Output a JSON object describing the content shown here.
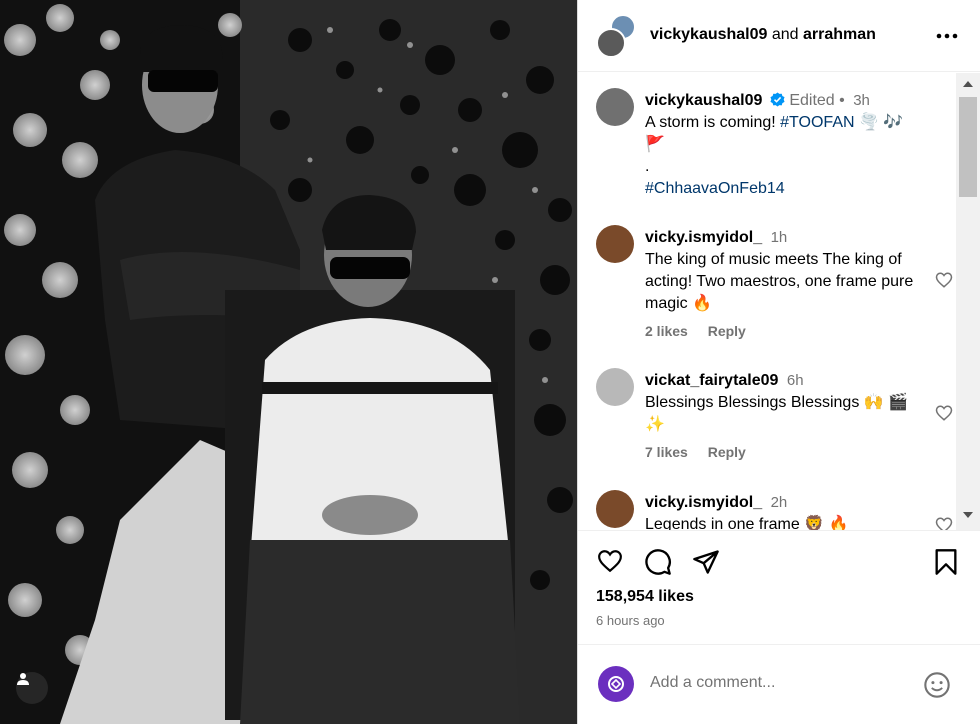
{
  "header": {
    "user1": "vickykaushal09",
    "conj": "and",
    "user2": "arrahman",
    "more_label": "•••"
  },
  "caption": {
    "username": "vickykaushal09",
    "edited": "Edited",
    "dot": "•",
    "time": "3h",
    "text": "A storm is coming! ",
    "hashtag1": "#TOOFAN",
    "emojis": "🌪️ 🎶 🚩",
    "dot_line": ".",
    "hashtag2": "#ChhaavaOnFeb14"
  },
  "comments": [
    {
      "username": "vicky.ismyidol_",
      "time": "1h",
      "text": "The king of music meets The king of acting! Two maestros, one frame pure magic 🔥",
      "likes": "2 likes",
      "reply": "Reply"
    },
    {
      "username": "vickat_fairytale09",
      "time": "6h",
      "text": "Blessings Blessings Blessings 🙌 🎬 ✨",
      "likes": "7 likes",
      "reply": "Reply"
    },
    {
      "username": "vicky.ismyidol_",
      "time": "2h",
      "text": "Legends in one frame 🦁 🔥"
    }
  ],
  "actions": {
    "likes": "158,954 likes",
    "ago": "6 hours ago"
  },
  "add_comment": {
    "placeholder": "Add a comment..."
  },
  "colors": {
    "hashtag": "#00376b",
    "verified": "#0095f6",
    "muted": "#737373"
  }
}
